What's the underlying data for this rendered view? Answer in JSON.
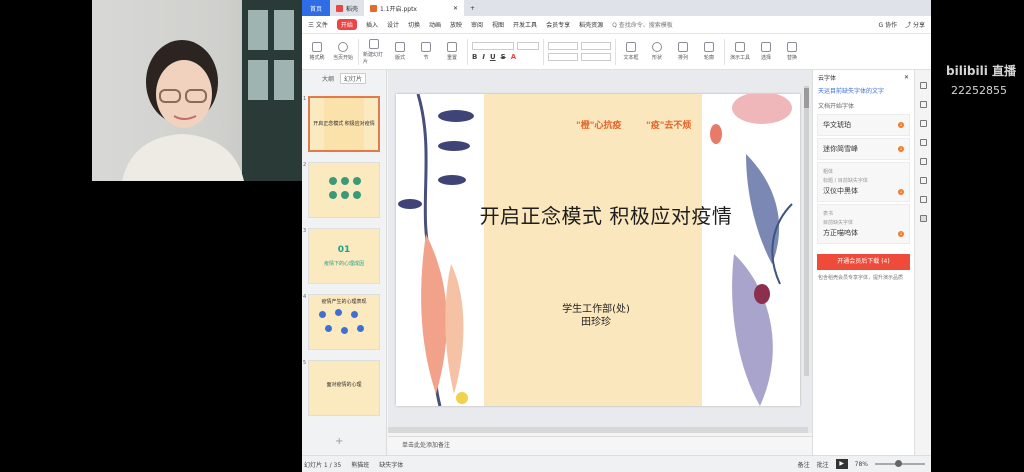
{
  "tabs": {
    "home": "首页",
    "t1": "稻壳",
    "t2": "1.1开启.pptx"
  },
  "menu": {
    "file": "三 文件",
    "items": [
      "开始",
      "插入",
      "设计",
      "切换",
      "动画",
      "放映",
      "审阅",
      "视图",
      "开发工具",
      "会员专享",
      "稻壳资源"
    ],
    "search": "Q 查找命令、搜索模板",
    "right": [
      "G 协作",
      "⤴ 分享"
    ]
  },
  "toolbar": {
    "labels": [
      "格式刷",
      "当页开始",
      "新建幻灯片",
      "版式",
      "节",
      "重置",
      "字体",
      "字号",
      "文本框",
      "形状",
      "排列",
      "轮廓",
      "演示工具",
      "选择",
      "替换"
    ]
  },
  "leftpanel": {
    "tab_outline": "大纲",
    "tab_slides": "幻灯片",
    "thumbs": [
      {
        "num": "1",
        "text": "开启正念模式 积极应对疫情"
      },
      {
        "num": "2",
        "text": ""
      },
      {
        "num": "3",
        "bignum": "01",
        "text": "疫情下的心理成因"
      },
      {
        "num": "4",
        "text": "疫情产生的心理表现"
      },
      {
        "num": "5",
        "text": "面对疫情的心理"
      }
    ],
    "add": "+"
  },
  "slide": {
    "tag1": "\"橙\"心抗疫",
    "tag2": "\"疫\"去不烦",
    "title": "开启正念模式  积极应对疫情",
    "sub1": "学生工作部(处)",
    "sub2": "田珍珍"
  },
  "notes": "单击此处添加备注",
  "status": {
    "slide_count": "幻灯片 1 / 35",
    "theme": "熊猫班",
    "missing_font": "缺失字体",
    "notes_btn": "备注",
    "comment_btn": "批注",
    "zoom": "78%"
  },
  "rightpane": {
    "title": "云字体",
    "link": "天运目前缺失字体的文字",
    "section": "文档开始字体",
    "fonts": [
      {
        "name": "华文琥珀",
        "tall": false
      },
      {
        "name": "迷你简雪峰",
        "tall": false
      },
      {
        "name": "汉仪中黑体",
        "small": "标题 / 目前缺失字体",
        "label": "粗体",
        "tall": true
      },
      {
        "name": "方正喵呜体",
        "small": "目前缺失字体",
        "label": "表书",
        "tall": true
      }
    ],
    "vip_button": "开通会员后下载 (4)",
    "vip_note": "包含稻壳会员专享字体，提升演示品质"
  },
  "overlay": {
    "brand": "bilibili 直播",
    "room_id": "22252855"
  },
  "colors": {
    "accent": "#2e6de6",
    "wps_red": "#e44444",
    "slide_bg": "#fbe7bd",
    "title_orange": "#e3652a"
  }
}
